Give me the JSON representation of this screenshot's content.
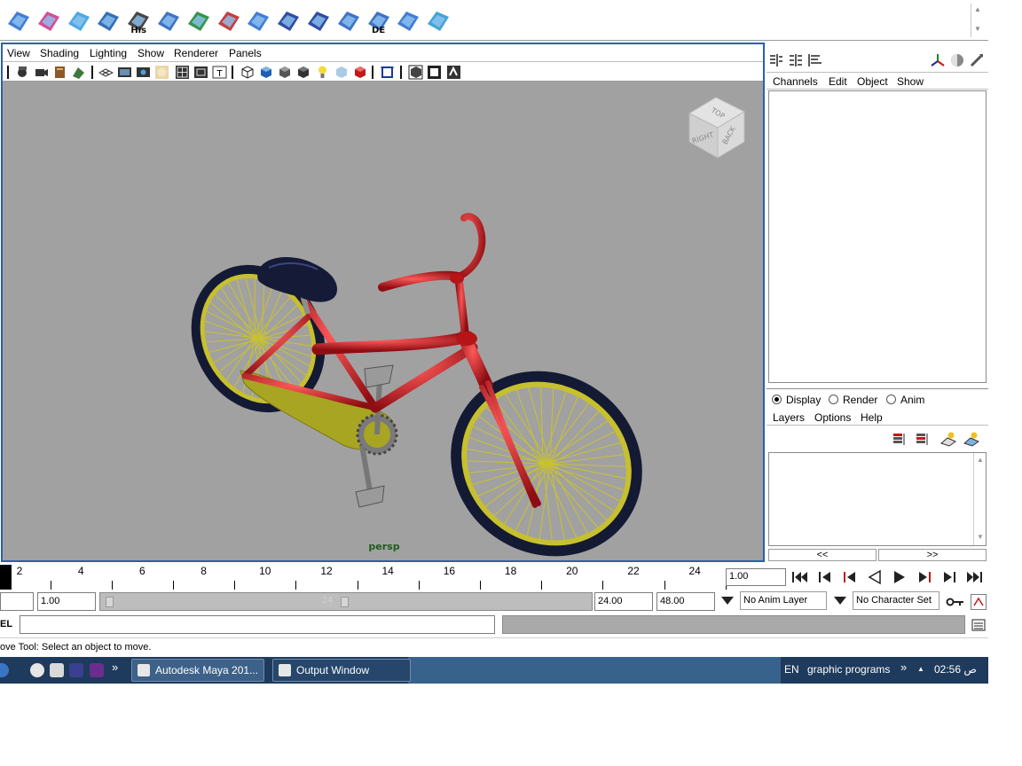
{
  "shelf": {
    "icons": [
      {
        "name": "poly-cube-select-icon",
        "caption": ""
      },
      {
        "name": "poly-sphere-select-icon",
        "caption": ""
      },
      {
        "name": "uv-grid-icon",
        "caption": ""
      },
      {
        "name": "cut-faces-icon",
        "caption": ""
      },
      {
        "name": "history-curve-icon",
        "caption": "His"
      },
      {
        "name": "extrude-face-icon",
        "caption": ""
      },
      {
        "name": "sphere-deform-icon",
        "caption": ""
      },
      {
        "name": "curve-tool-icon",
        "caption": ""
      },
      {
        "name": "uv-map-icon",
        "caption": ""
      },
      {
        "name": "soft-select-icon",
        "caption": ""
      },
      {
        "name": "soft-select-alt-icon",
        "caption": ""
      },
      {
        "name": "planar-project-icon",
        "caption": ""
      },
      {
        "name": "mesh-delete-icon",
        "caption": "DE"
      },
      {
        "name": "bend-tool-icon",
        "caption": ""
      },
      {
        "name": "move-manip-icon",
        "caption": ""
      }
    ]
  },
  "viewport": {
    "menu": [
      "View",
      "Shading",
      "Lighting",
      "Show",
      "Renderer",
      "Panels"
    ],
    "camera_label": "persp",
    "view_cube": {
      "top": "TOP",
      "right": "RIGHT",
      "back": "BACK"
    }
  },
  "channel_box": {
    "menu": [
      "Channels",
      "Edit",
      "Object",
      "Show"
    ]
  },
  "layers": {
    "tabs": [
      {
        "label": "Display",
        "selected": true
      },
      {
        "label": "Render",
        "selected": false
      },
      {
        "label": "Anim",
        "selected": false
      }
    ],
    "menu": [
      "Layers",
      "Options",
      "Help"
    ],
    "nav_prev": "<<",
    "nav_next": ">>"
  },
  "time_slider": {
    "ticks": [
      "2",
      "4",
      "6",
      "8",
      "10",
      "12",
      "14",
      "16",
      "18",
      "20",
      "22",
      "24"
    ],
    "current_frame": "1.00"
  },
  "range": {
    "start": "",
    "playback_start": "1.00",
    "ghost_end": "24",
    "playback_end": "24.00",
    "end": "48.00",
    "anim_layer": "No Anim Layer",
    "character_set": "No Character Set"
  },
  "command": {
    "label": "EL",
    "value": ""
  },
  "help_line": "ove Tool: Select an object to move.",
  "taskbar": {
    "apps": [
      {
        "label": "Autodesk Maya 201..."
      },
      {
        "label": "Output Window"
      }
    ],
    "more": "»",
    "language": "EN",
    "toolbar_label": "graphic programs",
    "tray_up": "▲",
    "clock": "02:56 ص"
  },
  "colors": {
    "viewport_bg": "#a1a1a1",
    "panel_border": "#2b5fae",
    "bike_frame": "#c0151b",
    "tire": "#141a33",
    "rim": "#c7c02e",
    "seat": "#151a36",
    "taskbar": "#1e3a5c"
  }
}
